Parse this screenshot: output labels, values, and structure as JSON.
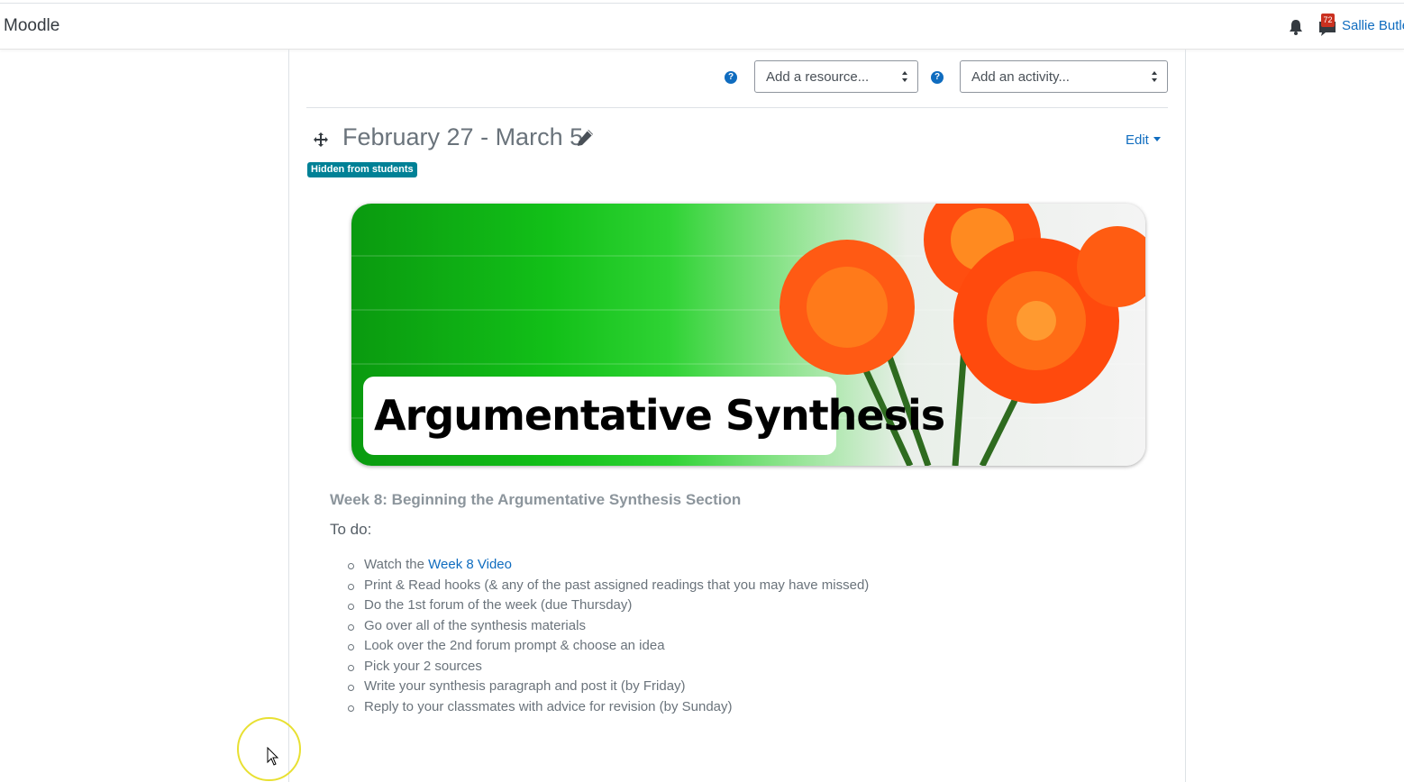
{
  "navbar": {
    "brand": "Moodle",
    "message_count": "72",
    "user_name": "Sallie Butle"
  },
  "toolbar": {
    "resource_select": "Add a resource...",
    "activity_select": "Add an activity..."
  },
  "section": {
    "title": "February 27 - March 5",
    "edit_label": "Edit",
    "hidden_badge": "Hidden from students",
    "banner_text": "Argumentative Synthesis",
    "week_heading": "Week 8: Beginning the Argumentative Synthesis Section",
    "todo_label": "To do:",
    "task_1_prefix": "Watch the ",
    "task_1_link": "Week 8 Video",
    "tasks": [
      "Print & Read hooks (& any of the past assigned readings that you may have missed)",
      "Do the 1st forum of the week (due Thursday)",
      "Go over all of the synthesis materials",
      "Look over the 2nd forum prompt & choose an idea",
      "Pick your 2 sources",
      "Write your synthesis paragraph and post it (by Friday)",
      "Reply to your classmates with advice for revision (by Sunday)"
    ]
  },
  "icons": {
    "help": "question-circle-icon",
    "move": "move-icon",
    "edit": "pencil-icon",
    "notifications": "bell-icon",
    "messages": "chat-icon"
  },
  "colors": {
    "link": "#0f6cbf",
    "badge": "#008196",
    "message_badge": "#ca3120"
  }
}
